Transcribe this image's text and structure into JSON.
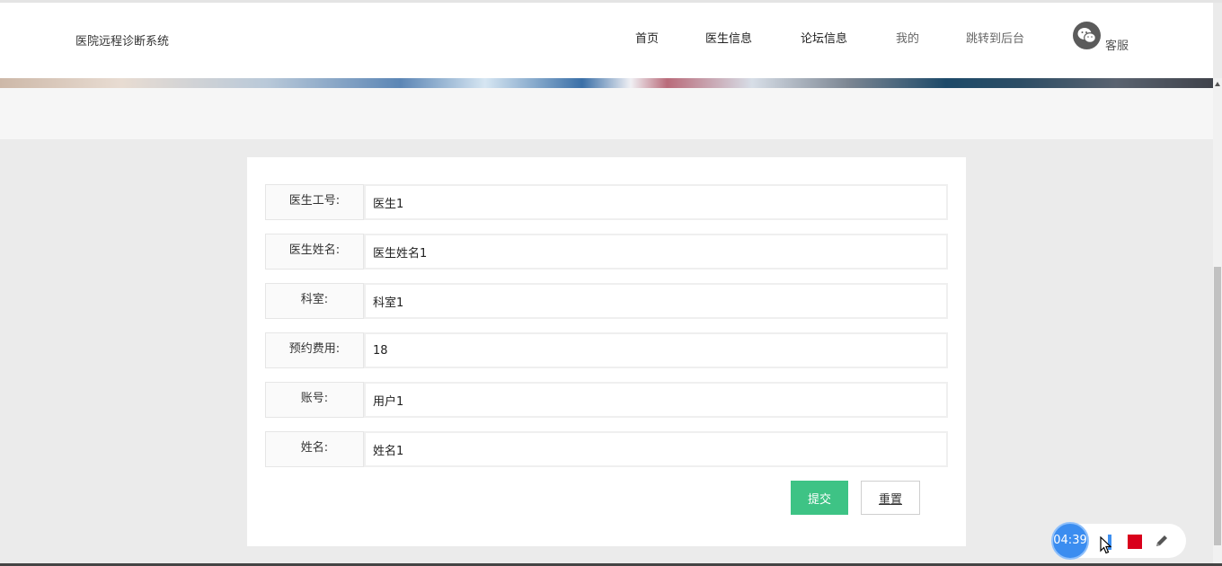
{
  "header": {
    "brand": "医院远程诊断系统",
    "nav": [
      "首页",
      "医生信息",
      "论坛信息",
      "我的",
      "跳转到后台"
    ],
    "service_label": "客服"
  },
  "form": {
    "rows": [
      {
        "label": "医生工号:",
        "value": "医生1"
      },
      {
        "label": "医生姓名:",
        "value": "医生姓名1"
      },
      {
        "label": "科室:",
        "value": "科室1"
      },
      {
        "label": "预约费用:",
        "value": "18"
      },
      {
        "label": "账号:",
        "value": "用户1"
      },
      {
        "label": "姓名:",
        "value": "姓名1"
      }
    ],
    "submit_label": "提交",
    "reset_label": "重置"
  },
  "recorder": {
    "time": "04:39"
  },
  "colors": {
    "submit": "#3ec385",
    "stop": "#d9001b",
    "timer": "#3b8df0"
  }
}
